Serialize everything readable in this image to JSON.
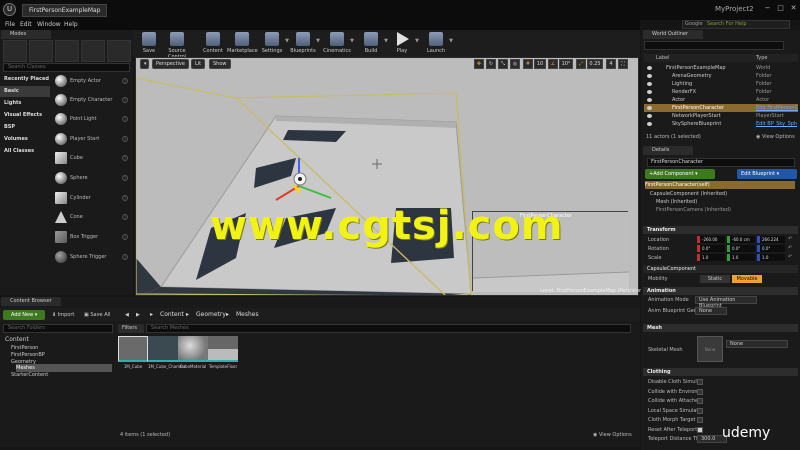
{
  "window": {
    "doc_tab": "FirstPersonExampleMap",
    "project_name": "MyProject2",
    "minimize": "−",
    "maximize": "□",
    "close": "✕"
  },
  "menu": [
    "File",
    "Edit",
    "Window",
    "Help"
  ],
  "search_help": {
    "engine": "Google",
    "placeholder": "Search For Help"
  },
  "modes": {
    "tab": "Modes",
    "search_placeholder": "Search Classes",
    "categories": [
      "Recently Placed",
      "Basic",
      "Lights",
      "Visual Effects",
      "BSP",
      "Volumes",
      "All Classes"
    ],
    "selected_category": "Basic",
    "items": [
      "Empty Actor",
      "Empty Character",
      "Point Light",
      "Player Start",
      "Cube",
      "Sphere",
      "Cylinder",
      "Cone",
      "Box Trigger",
      "Sphere Trigger"
    ]
  },
  "toolbar": [
    "Save",
    "Source Control",
    "Content",
    "Marketplace",
    "Settings",
    "Blueprints",
    "Cinematics",
    "Build",
    "Play",
    "Launch"
  ],
  "viewport": {
    "perspective": "Perspective",
    "lit": "Lit",
    "show": "Show",
    "grid_snap": "10",
    "rot_snap": "10°",
    "scale_snap": "0.25",
    "cam_speed": "4",
    "level_label": "Level:  FirstPersonExampleMap (Persistent)",
    "pip_title": "FirstPersonCharacter"
  },
  "watermark": "www.cgtsj.com",
  "content_browser": {
    "tab": "Content Browser",
    "add_new": "Add New",
    "import": "Import",
    "save_all": "Save All",
    "breadcrumb": [
      "Content",
      "Geometry",
      "Meshes"
    ],
    "search_folders": "Search Folders",
    "filters": "Filters",
    "search_meshes": "Search Meshes",
    "tree": [
      "Content",
      "FirstPerson",
      "FirstPersonBP",
      "Geometry",
      "Meshes",
      "StarterContent"
    ],
    "assets": [
      "1M_Cube",
      "1M_Cube_Chamfer",
      "CubeMaterial",
      "TemplateFloor"
    ],
    "item_count": "4 items (1 selected)",
    "view_options": "View Options"
  },
  "outliner": {
    "tab": "World Outliner",
    "search_placeholder": "",
    "col_label": "Label",
    "col_type": "Type",
    "rows": [
      {
        "label": "FirstPersonExampleMap",
        "type": "World"
      },
      {
        "label": "ArenaGeometry",
        "type": "Folder"
      },
      {
        "label": "Lighting",
        "type": "Folder"
      },
      {
        "label": "RenderFX",
        "type": "Folder"
      },
      {
        "label": "Actor",
        "type": "Actor"
      },
      {
        "label": "FirstPersonCharacter",
        "type": "Edit FirstPersonC"
      },
      {
        "label": "NetworkPlayerStart",
        "type": "PlayerStart"
      },
      {
        "label": "SkySphereBlueprint",
        "type": "Edit BP_Sky_Sph"
      }
    ],
    "selected_row": 5,
    "count": "11 actors (1 selected)",
    "view_options": "View Options"
  },
  "details": {
    "tab": "Details",
    "name": "FirstPersonCharacter",
    "add_component": "Add Component",
    "edit_blueprint": "Edit Blueprint",
    "components": [
      "FirstPersonCharacter(self)",
      "CapsuleComponent (Inherited)",
      "Mesh (Inherited)",
      "FirstPersonCamera (Inherited)"
    ],
    "transform": "Transform",
    "location_label": "Location",
    "location": [
      "-260.00",
      "-60.0 cm",
      "266.224"
    ],
    "rotation_label": "Rotation",
    "rotation": [
      "0.0°",
      "0.0°",
      "0.0°"
    ],
    "scale_label": "Scale",
    "scale": [
      "1.0",
      "1.0",
      "1.0"
    ],
    "capsule": "CapsuleComponent",
    "mobility_label": "Mobility",
    "mobility": [
      "Static",
      "Movable"
    ],
    "animation": "Animation",
    "anim_mode_label": "Animation Mode",
    "anim_mode": "Use Animation Blueprint",
    "anim_bp_label": "Anim Blueprint Gener.",
    "anim_bp": "None",
    "mesh_section": "Mesh",
    "skeletal_label": "Skeletal Mesh",
    "skeletal_none": "None",
    "skeletal_value": "None",
    "clothing": "Clothing",
    "cloth_props": [
      "Disable Cloth Simulat",
      "Collide with Environm",
      "Collide with Attached",
      "Local Space Simulatio",
      "Cloth Morph Target",
      "Reset After Teleport",
      "Teleport Distance Thr"
    ],
    "teleport_value": "300.0"
  },
  "branding": "udemy"
}
